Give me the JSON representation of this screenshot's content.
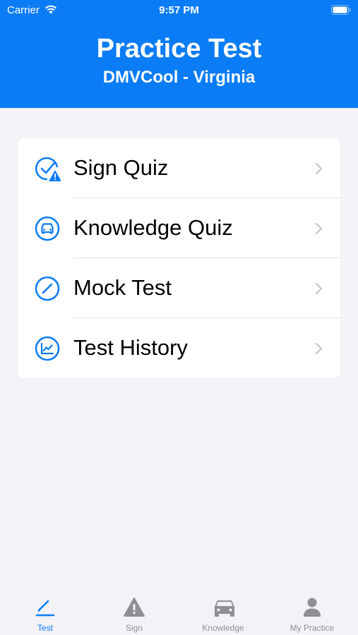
{
  "status_bar": {
    "carrier": "Carrier",
    "time": "9:57 PM"
  },
  "header": {
    "title": "Practice Test",
    "subtitle": "DMVCool - Virginia"
  },
  "menu": {
    "items": [
      {
        "label": "Sign Quiz",
        "icon": "check-warning-icon"
      },
      {
        "label": "Knowledge Quiz",
        "icon": "car-icon"
      },
      {
        "label": "Mock Test",
        "icon": "pencil-icon"
      },
      {
        "label": "Test History",
        "icon": "chart-icon"
      }
    ]
  },
  "tabs": [
    {
      "label": "Test",
      "icon": "pencil-icon",
      "active": true
    },
    {
      "label": "Sign",
      "icon": "warning-icon",
      "active": false
    },
    {
      "label": "Knowledge",
      "icon": "car-icon",
      "active": false
    },
    {
      "label": "My Practice",
      "icon": "person-icon",
      "active": false
    }
  ],
  "colors": {
    "accent": "#0a7cf5",
    "background": "#f2f2f7",
    "inactive": "#8e8e93"
  }
}
